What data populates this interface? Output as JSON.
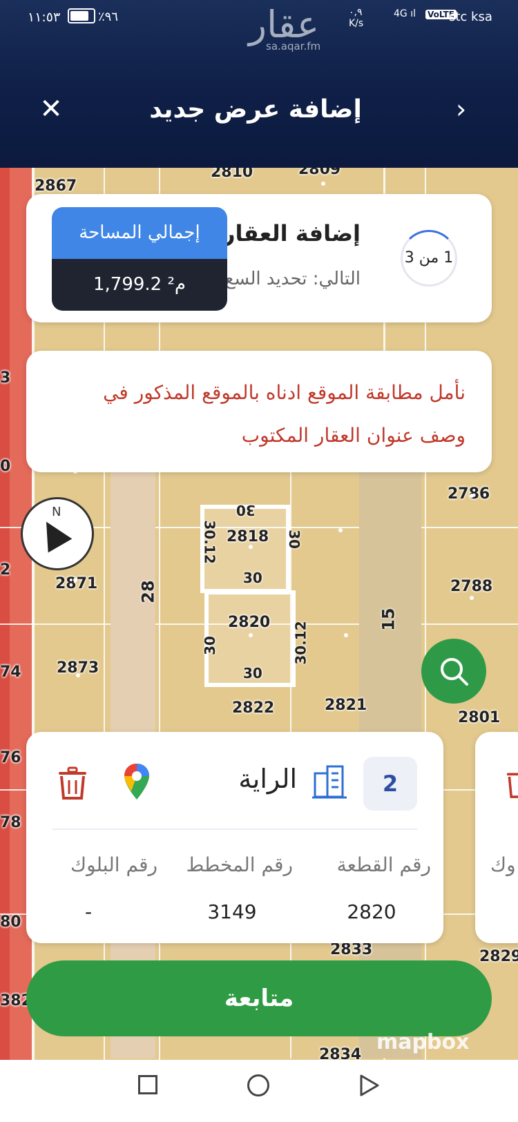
{
  "status": {
    "time": "١١:٥٣",
    "battery_pct": "٪٩٦",
    "net_speed": "٠,٩\nK/s",
    "signal": "4G ıl",
    "volte": "VoLTE",
    "carrier": "stc ksa"
  },
  "watermark": {
    "logo": "عقار",
    "site": "sa.aqar.fm"
  },
  "header": {
    "title": "إضافة عرض جديد",
    "close_icon": "close-icon",
    "back_icon": "chevron-right-icon"
  },
  "map": {
    "lot_numbers": [
      "2810",
      "2809",
      "2867",
      "2786",
      "2818",
      "2871",
      "2788",
      "2820",
      "2873",
      "2822",
      "2821",
      "2801",
      "2833",
      "2829",
      "2834"
    ],
    "dims": [
      "30",
      "30.12",
      "30",
      "28",
      "30",
      "30.12",
      "15",
      "30",
      "30"
    ],
    "edge_nums": [
      "2",
      "74",
      "76",
      "78",
      "80",
      "382",
      "3",
      "0"
    ],
    "attribution": "mapbox"
  },
  "step": {
    "title": "إضافة العقار",
    "next_label": "التالي: تحديد السع",
    "progress": "1 من 3",
    "progress_fraction": 0.3333
  },
  "area": {
    "label": "إجمالي المساحة",
    "value": "1,799.2 م²"
  },
  "warning": {
    "text": "نأمل مطابقة الموقع ادناه بالموقع المذكور في وصف عنوان العقار المكتوب"
  },
  "parcel": {
    "number": "2",
    "name": "الراية",
    "columns": [
      {
        "label": "رقم القطعة",
        "value": "2820"
      },
      {
        "label": "رقم المخطط",
        "value": "3149"
      },
      {
        "label": "رقم البلوك",
        "value": "-"
      }
    ],
    "peek_label": "وك"
  },
  "actions": {
    "continue_label": "متابعة"
  },
  "colors": {
    "header": "#0f1f47",
    "accent_blue": "#3f86e6",
    "green": "#2f9c45",
    "warning_red": "#c0392b"
  }
}
